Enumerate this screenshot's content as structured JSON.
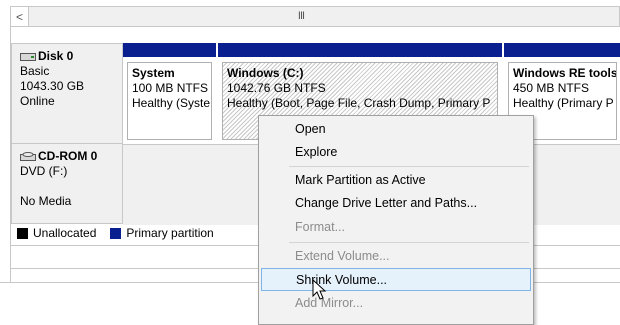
{
  "scrollbar": {
    "grip": "III",
    "left_arrow": "<"
  },
  "disks": [
    {
      "name": "Disk 0",
      "type": "Basic",
      "size": "1043.30 GB",
      "status": "Online",
      "partitions": [
        {
          "name": "System",
          "size": "100 MB NTFS",
          "status": "Healthy (Syste"
        },
        {
          "name": "Windows  (C:)",
          "size": "1042.76 GB NTFS",
          "status": "Healthy (Boot, Page File, Crash Dump, Primary P"
        },
        {
          "name": "Windows RE tools",
          "size": "450 MB NTFS",
          "status": "Healthy (Primary P"
        }
      ]
    },
    {
      "name": "CD-ROM 0",
      "type": "DVD (F:)",
      "media": "No Media"
    }
  ],
  "legend": [
    {
      "label": "Unallocated",
      "color": "#000000"
    },
    {
      "label": "Primary partition",
      "color": "#0a1f8f"
    }
  ],
  "context_menu": {
    "items": [
      {
        "label": "Open",
        "state": "enabled"
      },
      {
        "label": "Explore",
        "state": "enabled"
      },
      {
        "label": "Mark Partition as Active",
        "state": "enabled"
      },
      {
        "label": "Change Drive Letter and Paths...",
        "state": "enabled"
      },
      {
        "label": "Format...",
        "state": "disabled"
      },
      {
        "label": "Extend Volume...",
        "state": "disabled"
      },
      {
        "label": "Shrink Volume...",
        "state": "hovered"
      },
      {
        "label": "Add Mirror...",
        "state": "disabled"
      }
    ]
  },
  "colors": {
    "primary_partition": "#0a1f8f",
    "menu_hover": "#e5f1fb",
    "menu_hover_border": "#7eb4ea"
  }
}
